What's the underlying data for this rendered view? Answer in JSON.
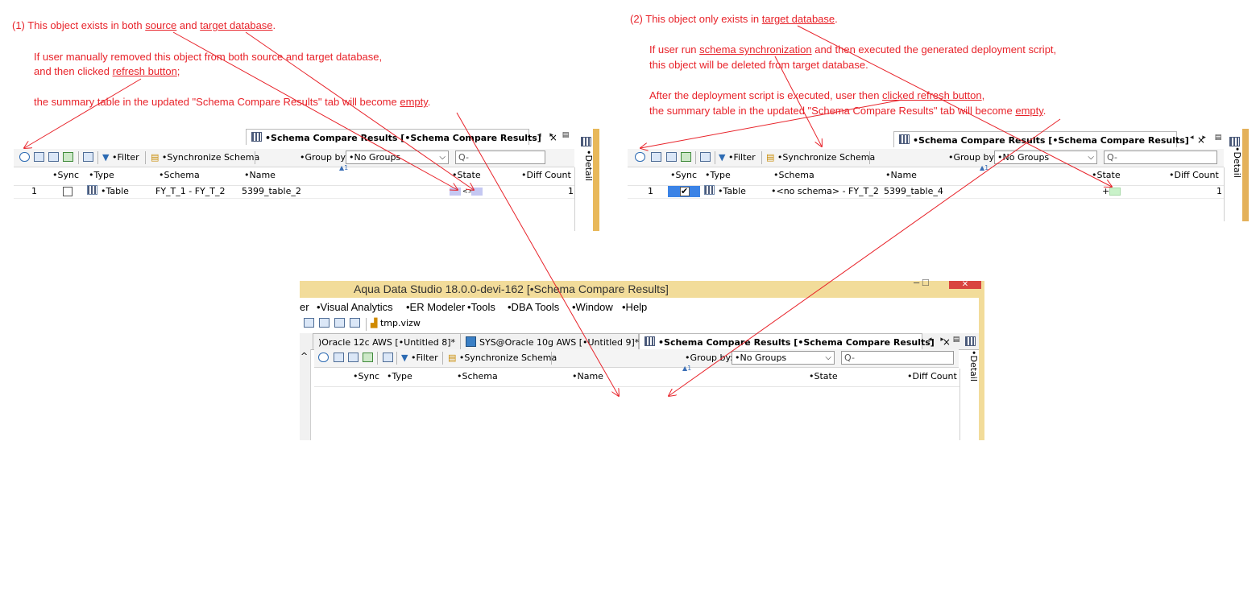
{
  "notes": {
    "n1": {
      "l1_a": "(1)  This object exists in both ",
      "l1_u1": "source",
      "l1_b": " and ",
      "l1_u2": "target database",
      "l1_c": ".",
      "l2": "If user manually removed this object from both source and target database,",
      "l3_a": "and then clicked ",
      "l3_u": "refresh button",
      "l3_b": ";",
      "l4_a": "the summary table in the updated \"Schema Compare Results\" tab will become ",
      "l4_u": "empty",
      "l4_b": "."
    },
    "n2": {
      "l1_a": "(2)  This object only exists in ",
      "l1_u": "target database",
      "l1_b": ".",
      "l2_a": "If user run ",
      "l2_u": "schema synchronization",
      "l2_b": " and then executed the generated deployment script,",
      "l3": "this object will be deleted from target database.",
      "l4_a": "After the deployment script is executed, user then ",
      "l4_u": "clicked refresh button",
      "l4_b": ",",
      "l5_a": "the summary table in the updated \"Schema Compare Results\" tab will become ",
      "l5_u": "empty",
      "l5_b": "."
    }
  },
  "panel_common": {
    "tab_label": "•Schema Compare Results [•Schema Compare Results]",
    "close": "×",
    "nav": "◂ ▸ ▤",
    "filter": "•Filter",
    "sync_schema": "•Synchronize Schema",
    "group_by_label": "•Group by:",
    "group_by_value": "•No Groups",
    "search_placeholder": "Q-",
    "sort_marker": "▲1",
    "detail": "•Detail",
    "columns": {
      "sync": "•Sync",
      "type": "•Type",
      "schema": "•Schema",
      "name": "•Name",
      "state": "•State",
      "diff": "•Diff Count"
    }
  },
  "panel1": {
    "row": {
      "num": "1",
      "type": "•Table",
      "schema": "FY_T_1 - FY_T_2",
      "name": "5399_table_2",
      "state_sym": "<>",
      "diff": "1"
    }
  },
  "panel2": {
    "row": {
      "num": "1",
      "check": "✔",
      "type": "•Table",
      "schema": "•<no schema> - FY_T_2",
      "name": "5399_table_4",
      "state_sym": "+",
      "diff": "1"
    }
  },
  "window": {
    "title": "Aqua Data Studio 18.0.0-devi-162 [•Schema Compare Results]",
    "win_controls": "–   □",
    "win_close": "✕",
    "menu": {
      "m0": "er",
      "m1": "•Visual Analytics",
      "m2": "•ER Modeler",
      "m3": "•Tools",
      "m4": "•DBA Tools",
      "m5": "•Window",
      "m6": "•Help"
    },
    "file_tab": "tmp.vizw",
    "tabs": {
      "t1": ")Oracle 12c AWS [•Untitled 8]*",
      "t2": "SYS@Oracle 10g AWS [•Untitled 9]*"
    }
  },
  "colors": {
    "annotation": "#e8232a",
    "titlebar": "#f2dc9a",
    "accent": "#e8b85a",
    "check_blue": "#3b83e6"
  }
}
